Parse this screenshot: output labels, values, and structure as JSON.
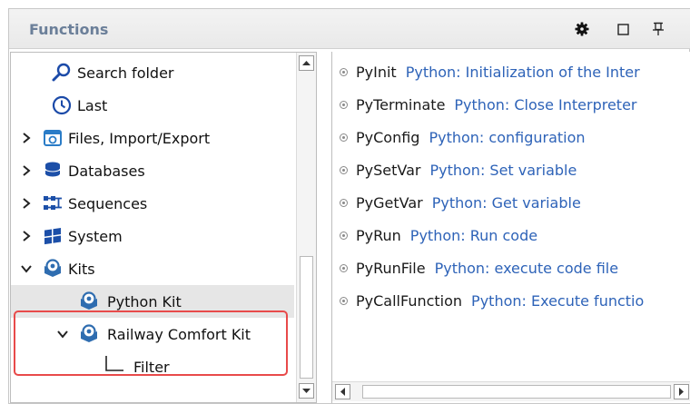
{
  "panel": {
    "title": "Functions",
    "toolbar_icons": [
      "gear-icon",
      "maximize-icon",
      "pin-icon"
    ]
  },
  "tree": {
    "items": [
      {
        "label": "Search folder",
        "icon": "search-icon",
        "expand": "none"
      },
      {
        "label": "Last",
        "icon": "clock-icon",
        "expand": "none"
      },
      {
        "label": "Files, Import/Export",
        "icon": "files-icon",
        "expand": "collapsed"
      },
      {
        "label": "Databases",
        "icon": "database-icon",
        "expand": "collapsed"
      },
      {
        "label": "Sequences",
        "icon": "sequences-icon",
        "expand": "collapsed"
      },
      {
        "label": "System",
        "icon": "windows-icon",
        "expand": "collapsed"
      },
      {
        "label": "Kits",
        "icon": "kit-icon",
        "expand": "expanded"
      },
      {
        "label": "Python Kit",
        "icon": "kit-icon",
        "expand": "none",
        "selected": true
      },
      {
        "label": "Railway Comfort Kit",
        "icon": "kit-icon",
        "expand": "expanded"
      },
      {
        "label": "Filter",
        "icon": "tree-branch-icon",
        "expand": "none"
      }
    ],
    "highlight_color": "#e84a4a"
  },
  "functions": [
    {
      "name": "PyInit",
      "desc": "Python: Initialization of the Inter"
    },
    {
      "name": "PyTerminate",
      "desc": "Python: Close Interpreter"
    },
    {
      "name": "PyConfig",
      "desc": "Python: configuration"
    },
    {
      "name": "PySetVar",
      "desc": "Python: Set variable"
    },
    {
      "name": "PyGetVar",
      "desc": "Python: Get variable"
    },
    {
      "name": "PyRun",
      "desc": "Python: Run code"
    },
    {
      "name": "PyRunFile",
      "desc": "Python: execute code file"
    },
    {
      "name": "PyCallFunction",
      "desc": "Python: Execute functio"
    }
  ],
  "colors": {
    "title": "#6b7f99",
    "description": "#2e63b8",
    "kit_icon": "#2f6db0"
  }
}
